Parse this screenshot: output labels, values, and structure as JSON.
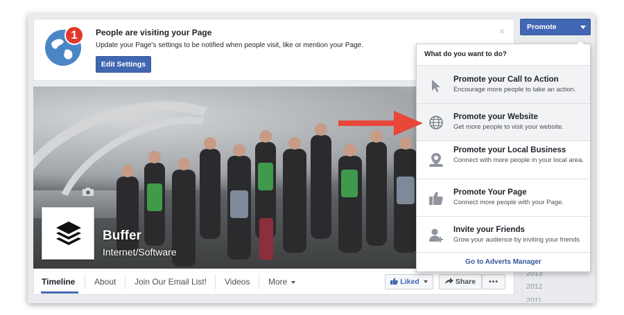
{
  "notice": {
    "badge_count": "1",
    "title": "People are visiting your Page",
    "text": "Update your Page's settings to be notified when people visit, like or mention your Page.",
    "button": "Edit Settings",
    "close": "×"
  },
  "page": {
    "name": "Buffer",
    "category": "Internet/Software"
  },
  "nav": {
    "tabs": [
      "Timeline",
      "About",
      "Join Our Email List!",
      "Videos",
      "More"
    ],
    "liked_label": "Liked",
    "share_label": "Share",
    "more_dots": "•••"
  },
  "promote": {
    "button_label": "Promote",
    "menu_heading": "What do you want to do?",
    "items": [
      {
        "title": "Promote your Call to Action",
        "desc": "Encourage more people to take an action."
      },
      {
        "title": "Promote your Website",
        "desc": "Get more people to visit your website."
      },
      {
        "title": "Promote your Local Business",
        "desc": "Connect with more people in your local area."
      },
      {
        "title": "Promote Your Page",
        "desc": "Connect more people with your Page."
      },
      {
        "title": "Invite your Friends",
        "desc": "Grow your audience by inviting your friends"
      }
    ],
    "footer_link": "Go to Adverts Manager"
  },
  "timeline_years": [
    "2013",
    "2012",
    "2011"
  ],
  "colors": {
    "fb_blue": "#4267b2",
    "badge_red": "#e0392b",
    "arrow_red": "#e8473a"
  }
}
